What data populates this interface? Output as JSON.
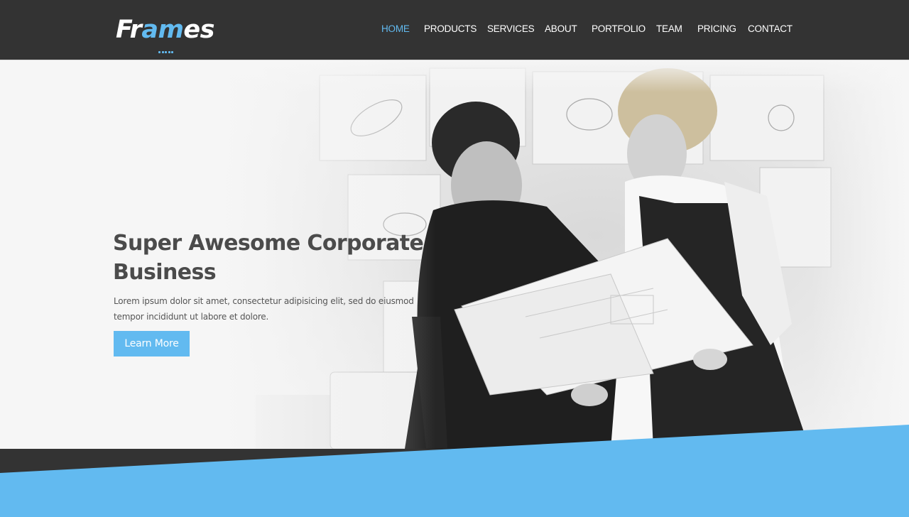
{
  "brand": {
    "logo_prefix": "Fr",
    "logo_accent": "am",
    "logo_suffix": "es"
  },
  "nav": {
    "items": [
      {
        "label": "HOME",
        "active": true
      },
      {
        "label": "PRODUCTS",
        "active": false
      },
      {
        "label": "SERVICES",
        "active": false
      },
      {
        "label": "ABOUT",
        "active": false
      },
      {
        "label": "PORTFOLIO",
        "active": false
      },
      {
        "label": "TEAM",
        "active": false
      },
      {
        "label": "PRICING",
        "active": false
      },
      {
        "label": "CONTACT",
        "active": false
      }
    ]
  },
  "hero": {
    "title": "Super Awesome Corporate Business",
    "text": "Lorem ipsum dolor sit amet, consectetur adipisicing elit, sed do eiusmod tempor incididunt ut labore et dolore.",
    "button_label": "Learn More"
  },
  "colors": {
    "accent": "#62baf0",
    "nav_background": "#333333",
    "hero_background": "#f6f6f6",
    "heading": "#4b4b4b"
  }
}
